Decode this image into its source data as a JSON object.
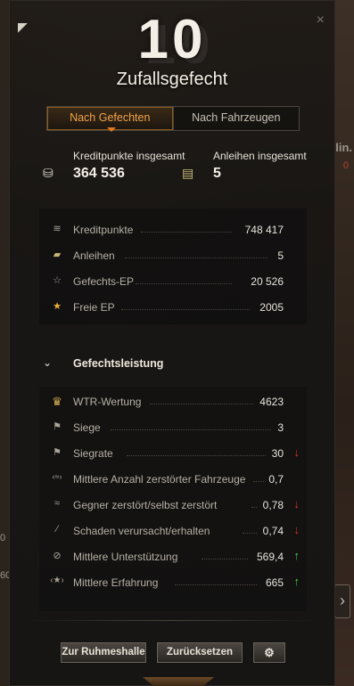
{
  "header": {
    "battles_count": "10",
    "title": "Zufallsgefecht",
    "close_label": "×"
  },
  "tabs": [
    {
      "label": "Nach Gefechten",
      "active": true
    },
    {
      "label": "Nach Fahrzeugen",
      "active": false
    }
  ],
  "summary": {
    "credits": {
      "label": "Kreditpunkte insgesamt",
      "value": "364 536",
      "icon": "coins-icon"
    },
    "bonds": {
      "label": "Anleihen insgesamt",
      "value": "5",
      "icon": "bonds-icon"
    }
  },
  "earnings": [
    {
      "icon": "credits-icon",
      "glyph": "≋",
      "label": "Kreditpunkte",
      "value": "748 417"
    },
    {
      "icon": "bonds-icon",
      "glyph": "▰",
      "label": "Anleihen",
      "value": "5"
    },
    {
      "icon": "xp-star-icon",
      "glyph": "☆",
      "label": "Gefechts-EP",
      "value": "20 526"
    },
    {
      "icon": "free-xp-icon",
      "glyph": "★",
      "label": "Freie EP",
      "value": "2005"
    }
  ],
  "performance": {
    "header": "Gefechtsleistung",
    "rows": [
      {
        "icon": "wtr-badge-icon",
        "glyph": "♛",
        "label": "WTR-Wertung",
        "value": "4623",
        "trend": ""
      },
      {
        "icon": "flag-icon",
        "glyph": "⚑",
        "label": "Siege",
        "value": "3",
        "trend": ""
      },
      {
        "icon": "flag-icon",
        "glyph": "⚑",
        "label": "Siegrate",
        "value": "30",
        "trend": "down"
      },
      {
        "icon": "destroyed-vehicles-icon",
        "glyph": "‹≈›",
        "label": "Mittlere Anzahl zerstörter Fahrzeuge",
        "value": "0,7",
        "trend": ""
      },
      {
        "icon": "kill-death-icon",
        "glyph": "≈",
        "label": "Gegner zerstört/selbst zerstört",
        "value": "0,78",
        "trend": "down"
      },
      {
        "icon": "damage-ratio-icon",
        "glyph": "⁄",
        "label": "Schaden verursacht/erhalten",
        "value": "0,74",
        "trend": "down"
      },
      {
        "icon": "assist-icon",
        "glyph": "⊘",
        "label": "Mittlere Unterstützung",
        "value": "569,4",
        "trend": "up"
      },
      {
        "icon": "avg-xp-icon",
        "glyph": "‹★›",
        "label": "Mittlere Erfahrung",
        "value": "665",
        "trend": "up"
      }
    ]
  },
  "footer": {
    "hall_of_fame": "Zur Ruhmeshalle",
    "reset": "Zurücksetzen",
    "settings_icon": "gear-icon"
  },
  "colors": {
    "accent": "#f2a34a",
    "trend_down": "#d8322a",
    "trend_up": "#48d048"
  },
  "background": {
    "right_text_1": "lin.",
    "right_text_2": "0",
    "left_text_1": "0",
    "left_text_2": "60"
  }
}
